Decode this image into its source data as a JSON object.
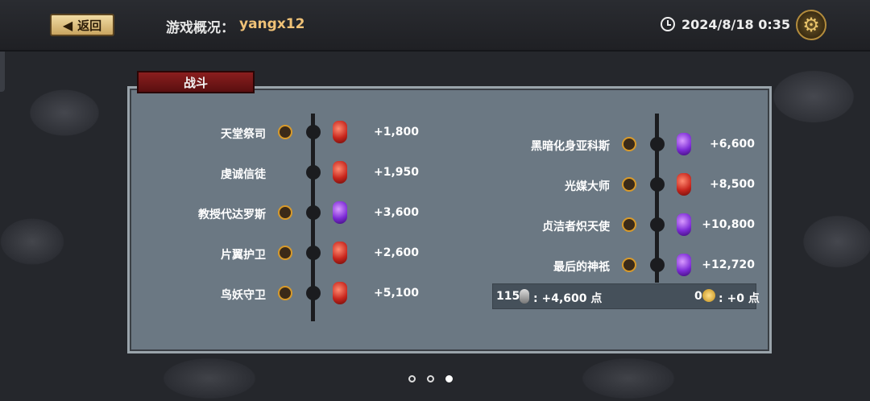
{
  "header": {
    "back_label": "返回",
    "title_label": "游戏概况：",
    "username": "yangx12",
    "datetime": "2024/8/18 0:35"
  },
  "panel": {
    "tab_label": "战斗",
    "left_rows": [
      {
        "name": "天堂祭司",
        "value": "+1,800",
        "gem": "red",
        "has_icon": true
      },
      {
        "name": "虔诚信徒",
        "value": "+1,950",
        "gem": "red",
        "has_icon": false
      },
      {
        "name": "教授代达罗斯",
        "value": "+3,600",
        "gem": "purple",
        "has_icon": true
      },
      {
        "name": "片翼护卫",
        "value": "+2,600",
        "gem": "red",
        "has_icon": true
      },
      {
        "name": "鸟妖守卫",
        "value": "+5,100",
        "gem": "red",
        "has_icon": true
      }
    ],
    "right_rows": [
      {
        "name": "黑暗化身亚科斯",
        "value": "+6,600",
        "gem": "purple"
      },
      {
        "name": "光媒大师",
        "value": "+8,500",
        "gem": "red"
      },
      {
        "name": "贞洁者炽天使",
        "value": "+10,800",
        "gem": "purple"
      },
      {
        "name": "最后的神祇",
        "value": "+12,720",
        "gem": "purple"
      }
    ],
    "summary": {
      "count": "115",
      "points_left": ": +4,600 点",
      "coins": "0",
      "points_right": ": +0 点"
    }
  },
  "pagination": {
    "pages": 3,
    "active": 3
  },
  "colors": {
    "accent_gold": "#f0c277",
    "tab_red": "#8a1e1e",
    "panel": "#6b7883",
    "gem_red": "#c7261d",
    "gem_purple": "#7d2cd6"
  }
}
